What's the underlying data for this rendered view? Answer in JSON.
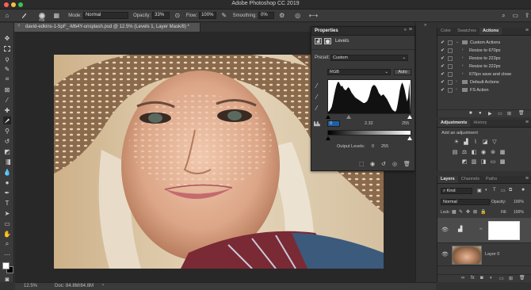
{
  "app": {
    "title": "Adobe Photoshop CC 2019"
  },
  "options_bar": {
    "brush_size": "700",
    "mode_label": "Mode:",
    "mode_value": "Normal",
    "opacity_label": "Opacity:",
    "opacity_value": "33%",
    "flow_label": "Flow:",
    "flow_value": "100%",
    "smoothing_label": "Smoothing:",
    "smoothing_value": "0%"
  },
  "document": {
    "tab_title": "david-edkins-1-5pF_-Mb4Y-unsplash.psd @ 12.5% (Levels 1, Layer Mask/8) *",
    "close_glyph": "×"
  },
  "status_bar": {
    "zoom": "12.5%",
    "doc_info": "Doc: 84.8M/84.8M"
  },
  "properties_panel": {
    "tab": "Properties",
    "section": "Levels",
    "preset_label": "Preset:",
    "preset_value": "Custom",
    "channel_value": "RGB",
    "auto_button": "Auto",
    "input_black": "0",
    "input_gamma": "2.32",
    "input_white": "255",
    "output_label": "Output Levels:",
    "output_black": "0",
    "output_white": "255"
  },
  "actions_panel": {
    "tabs": [
      "Color",
      "Swatches",
      "Actions"
    ],
    "active_tab": "Actions",
    "items": [
      {
        "label": "Custom Actions",
        "level": 0,
        "expanded": true
      },
      {
        "label": "Resize to 670px",
        "level": 1
      },
      {
        "label": "Resize to 223px",
        "level": 1
      },
      {
        "label": "Resize to 222px",
        "level": 1
      },
      {
        "label": "670px save and close",
        "level": 1
      },
      {
        "label": "Default Actions",
        "level": 0
      },
      {
        "label": "FS Action",
        "level": 0
      }
    ]
  },
  "adjustments_panel": {
    "tabs": [
      "Adjustments",
      "History"
    ],
    "active_tab": "Adjustments",
    "add_label": "Add an adjustment"
  },
  "layers_panel": {
    "tabs": [
      "Layers",
      "Channels",
      "Paths"
    ],
    "active_tab": "Layers",
    "kind_filter": "Kind",
    "blend_mode": "Normal",
    "opacity_label": "Opacity:",
    "opacity_value": "100%",
    "lock_label": "Lock:",
    "fill_label": "Fill:",
    "fill_value": "100%",
    "layers": [
      {
        "name": "",
        "type": "levels-adjustment"
      },
      {
        "name": "Layer 0",
        "type": "image"
      }
    ]
  },
  "histogram": [
    4,
    6,
    10,
    16,
    28,
    44,
    58,
    70,
    78,
    80,
    74,
    68,
    70,
    64,
    60,
    58,
    62,
    66,
    64,
    58,
    52,
    48,
    44,
    40,
    38,
    36,
    34,
    32,
    30,
    28,
    26,
    26,
    28,
    30,
    36,
    44,
    56,
    66,
    70,
    72,
    70,
    66,
    60,
    52,
    48,
    44,
    46,
    48,
    44,
    40,
    36,
    30,
    24,
    18,
    12,
    8,
    6,
    4,
    8,
    22,
    40,
    60,
    72,
    78,
    70,
    60,
    44,
    30,
    40,
    78
  ],
  "colors": {
    "accent_tab_underline": "#2d8ceb",
    "panel_bg": "#393939",
    "dark_bg": "#282828",
    "selected_row": "#4b4b4b"
  }
}
